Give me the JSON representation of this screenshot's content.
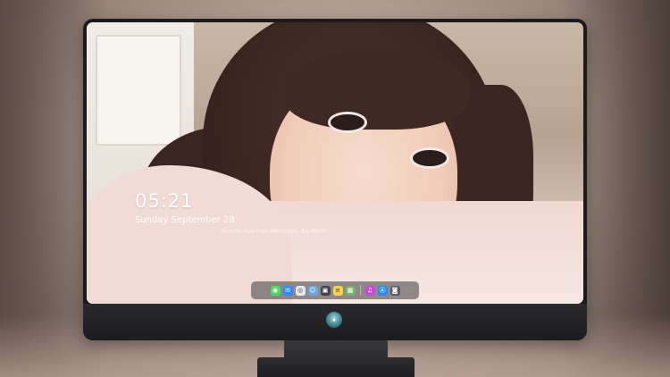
{
  "lockscreen": {
    "time": "05:21",
    "date": "Sunday  September  28",
    "quote": "是否有些回忆 可以永远不褪色 即使岁月如此匆匆 - Bing ENGLISH"
  },
  "dock": {
    "apps": [
      {
        "name": "messages-icon",
        "color": "#4cd964",
        "glyph": "◉"
      },
      {
        "name": "mail-icon",
        "color": "#2f8cff",
        "glyph": "✉"
      },
      {
        "name": "safari-icon",
        "color": "#e9e9ee",
        "glyph": "◎"
      },
      {
        "name": "finder-icon",
        "color": "#6aa7e8",
        "glyph": "☺"
      },
      {
        "name": "movie-clapper-icon",
        "color": "#444448",
        "glyph": "▣"
      },
      {
        "name": "notes-icon",
        "color": "#f5d44a",
        "glyph": "≡"
      },
      {
        "name": "preview-icon",
        "color": "#7bb36a",
        "glyph": "▦"
      },
      {
        "name": "music-icon",
        "color": "#c74bd6",
        "glyph": "♫"
      },
      {
        "name": "app-store-icon",
        "color": "#2a8bf2",
        "glyph": "Ⓐ"
      },
      {
        "name": "camera-icon",
        "color": "#5a5a60",
        "glyph": "◙"
      }
    ]
  },
  "colors": {
    "bezel": "#1b1b1d",
    "dock_background": "#3c3c42"
  }
}
